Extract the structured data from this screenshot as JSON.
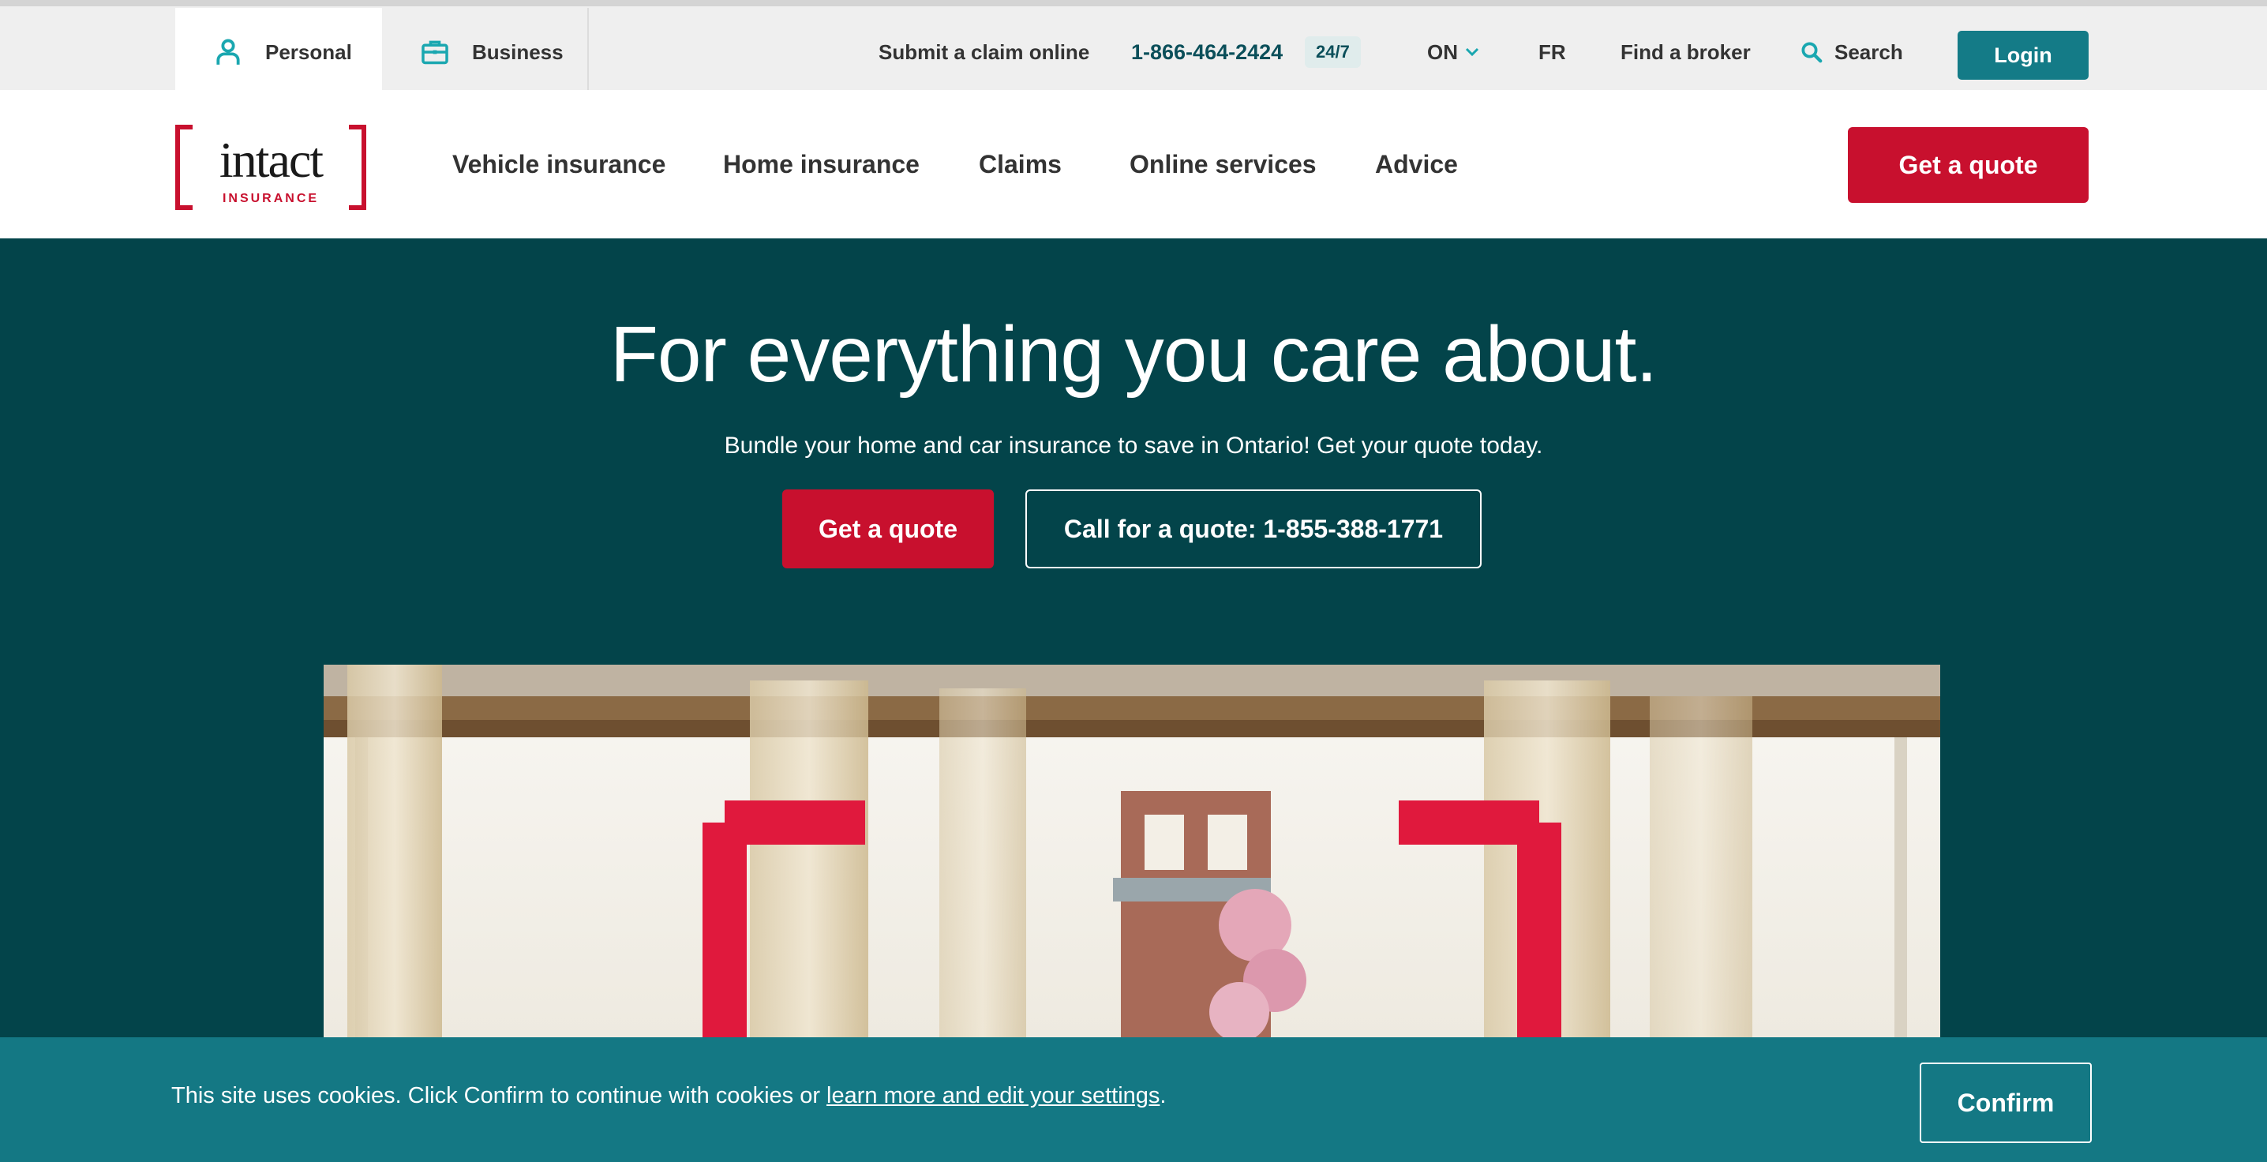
{
  "topbar": {
    "segments": [
      {
        "label": "Personal",
        "icon": "person-icon"
      },
      {
        "label": "Business",
        "icon": "briefcase-icon"
      }
    ],
    "claim_link": "Submit a claim online",
    "phone": "1-866-464-2424",
    "phone_badge": "24/7",
    "province": "ON",
    "language": "FR",
    "broker_link": "Find a broker",
    "search_label": "Search",
    "login_label": "Login"
  },
  "header": {
    "logo": {
      "wordmark": "intact",
      "subtext": "INSURANCE"
    },
    "nav": [
      "Vehicle insurance",
      "Home insurance",
      "Claims",
      "Online services",
      "Advice"
    ],
    "quote_button": "Get a quote"
  },
  "hero": {
    "title": "For everything you care about.",
    "subtitle": "Bundle your home and car insurance to save in Ontario! Get your quote today.",
    "primary_button": "Get a quote",
    "secondary_button": "Call for a quote: 1-855-388-1771"
  },
  "cookie": {
    "text_before": "This site uses cookies. Click Confirm to continue with cookies or ",
    "link_text": "learn more and edit your settings",
    "text_after": ".",
    "confirm_label": "Confirm"
  },
  "colors": {
    "brand_red": "#c8102e",
    "teal_dark": "#03444a",
    "teal": "#147b87",
    "accent_teal_icon": "#1aa7b0"
  }
}
